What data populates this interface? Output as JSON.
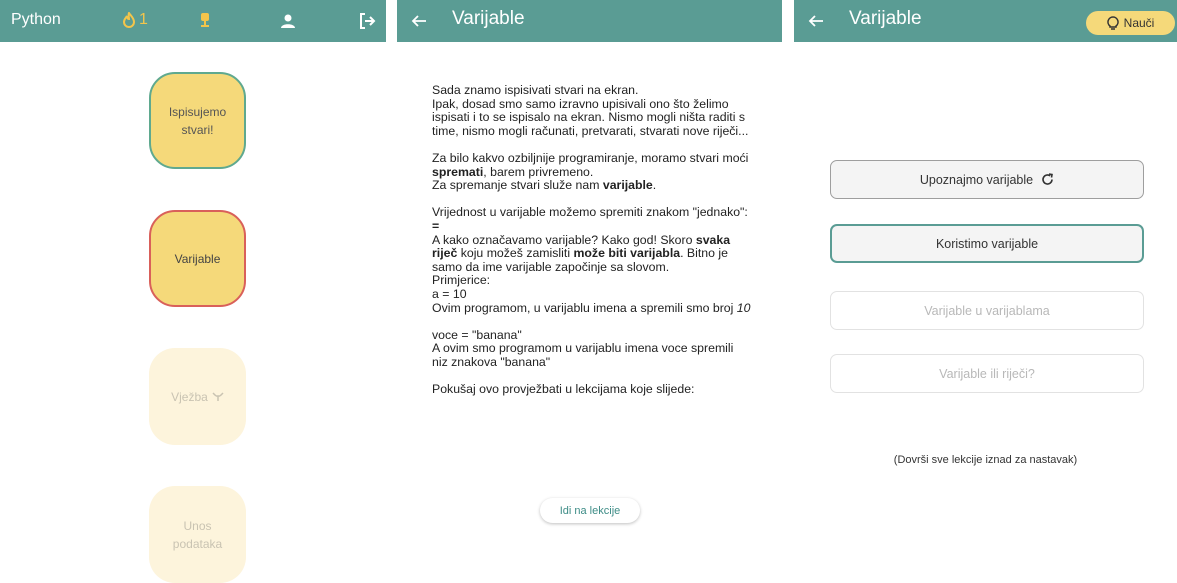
{
  "colors": {
    "topbar": "#5a9c94",
    "accent_yellow": "#f5d97a",
    "streak_orange": "#f3c54b",
    "active_border": "#d9605a"
  },
  "panel1": {
    "app_name": "Python",
    "streak_count": "1",
    "icons": [
      "fire-icon",
      "trophy-icon",
      "profile-icon",
      "logout-icon"
    ],
    "nodes": [
      {
        "label": "Ispisujemo stvari!",
        "state": "done"
      },
      {
        "label": "Varijable",
        "state": "active"
      },
      {
        "label": "Vježba",
        "state": "locked",
        "icon": "dumbbell-icon"
      },
      {
        "label": "Unos podataka",
        "state": "locked"
      }
    ]
  },
  "panel2": {
    "title": "Varijable",
    "text": {
      "p1": "Sada znamo ispisivati stvari na ekran.",
      "p1b": "Ipak, dosad smo samo izravno upisivali ono što želimo ispisati i to se ispisalo na ekran. Nismo mogli ništa raditi s time, nismo mogli računati, pretvarati, stvarati nove riječi...",
      "p2a": "Za bilo kakvo ozbiljnije programiranje, moramo stvari moći ",
      "p2b": "spremati",
      "p2c": ", barem privremeno.",
      "p2d": "Za spremanje stvari služe nam ",
      "p2e": "varijable",
      "p2f": ".",
      "p3a": "Vrijednost u varijable možemo spremiti znakom \"jednako\": ",
      "p3b": "=",
      "p3c": "A kako označavamo varijable? Kako god! Skoro ",
      "p3d": "svaka riječ",
      "p3e": " koju možeš zamisliti ",
      "p3f": "može biti varijabla",
      "p3g": ". Bitno je samo da ime varijable započinje sa slovom.",
      "p3h": "Primjerice:",
      "p3i": "a = 10",
      "p3j": "Ovim programom, u varijablu imena a spremili smo broj ",
      "p3k": "10",
      "p4a": "voce = \"banana\"",
      "p4b": "A ovim smo programom u varijablu imena voce spremili niz znakova \"banana\"",
      "p5": "Pokušaj ovo provježbati u lekcijama koje slijede:"
    },
    "button": "Idi na lekcije"
  },
  "panel3": {
    "title": "Varijable",
    "learn_button": "Nauči",
    "lessons": [
      {
        "label": "Upoznajmo varijable",
        "state": "completed"
      },
      {
        "label": "Koristimo varijable",
        "state": "current"
      },
      {
        "label": "Varijable u varijablama",
        "state": "locked"
      },
      {
        "label": "Varijable ili riječi?",
        "state": "locked"
      }
    ],
    "footer": "(Dovrši sve lekcije iznad za nastavak)"
  }
}
